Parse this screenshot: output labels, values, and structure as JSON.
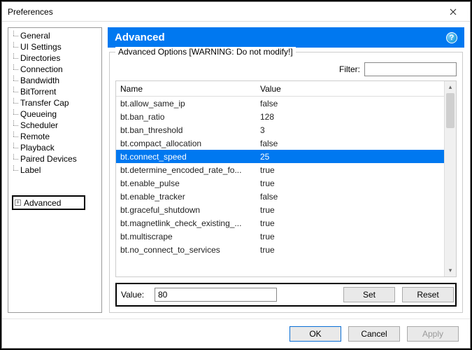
{
  "window": {
    "title": "Preferences"
  },
  "sidebar": {
    "items": [
      "General",
      "UI Settings",
      "Directories",
      "Connection",
      "Bandwidth",
      "BitTorrent",
      "Transfer Cap",
      "Queueing",
      "Scheduler",
      "Remote",
      "Playback",
      "Paired Devices",
      "Label"
    ],
    "advanced_label": "Advanced"
  },
  "header": {
    "title": "Advanced",
    "help_glyph": "?"
  },
  "group": {
    "legend": "Advanced Options [WARNING: Do not modify!]",
    "filter_label": "Filter:",
    "filter_value": ""
  },
  "table": {
    "col_name": "Name",
    "col_value": "Value",
    "selected_index": 4,
    "rows": [
      {
        "name": "bt.allow_same_ip",
        "value": "false"
      },
      {
        "name": "bt.ban_ratio",
        "value": "128"
      },
      {
        "name": "bt.ban_threshold",
        "value": "3"
      },
      {
        "name": "bt.compact_allocation",
        "value": "false"
      },
      {
        "name": "bt.connect_speed",
        "value": "25"
      },
      {
        "name": "bt.determine_encoded_rate_fo...",
        "value": "true"
      },
      {
        "name": "bt.enable_pulse",
        "value": "true"
      },
      {
        "name": "bt.enable_tracker",
        "value": "false"
      },
      {
        "name": "bt.graceful_shutdown",
        "value": "true"
      },
      {
        "name": "bt.magnetlink_check_existing_...",
        "value": "true"
      },
      {
        "name": "bt.multiscrape",
        "value": "true"
      },
      {
        "name": "bt.no_connect_to_services",
        "value": "true"
      }
    ]
  },
  "value_editor": {
    "label": "Value:",
    "value": "80",
    "set_label": "Set",
    "reset_label": "Reset"
  },
  "footer": {
    "ok": "OK",
    "cancel": "Cancel",
    "apply": "Apply"
  }
}
